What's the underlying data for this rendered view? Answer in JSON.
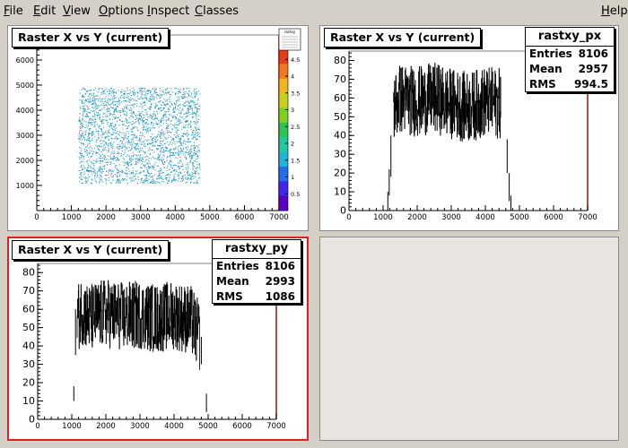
{
  "menu": {
    "file": {
      "u": "F",
      "rest": "ile"
    },
    "edit": {
      "u": "E",
      "rest": "dit"
    },
    "view": {
      "u": "V",
      "rest": "iew"
    },
    "options": {
      "u": "O",
      "rest": "ptions"
    },
    "inspect": {
      "u": "I",
      "rest": "nspect"
    },
    "classes": {
      "u": "C",
      "rest": "lasses"
    },
    "help": {
      "u": "H",
      "rest": "elp"
    }
  },
  "pads": {
    "top_left": {
      "title": "Raster X vs Y (current)",
      "palette_header": "rastxy",
      "palette_ticks": [
        "0.5",
        "1",
        "1.5",
        "2",
        "2.5",
        "3",
        "3.5",
        "4",
        "4.5"
      ],
      "x_ticks": [
        "0",
        "1000",
        "2000",
        "3000",
        "4000",
        "5000",
        "6000",
        "7000"
      ],
      "y_ticks": [
        "1000",
        "2000",
        "3000",
        "4000",
        "5000",
        "6000"
      ]
    },
    "top_right": {
      "title": "Raster X vs Y (current)",
      "stats": {
        "name": "rastxy_px",
        "entries_label": "Entries",
        "entries": "8106",
        "mean_label": "Mean",
        "mean": "2957",
        "rms_label": "RMS",
        "rms": "994.5"
      },
      "x_ticks": [
        "0",
        "1000",
        "2000",
        "3000",
        "4000",
        "5000",
        "6000",
        "7000"
      ],
      "y_ticks": [
        "0",
        "10",
        "20",
        "30",
        "40",
        "50",
        "60",
        "70",
        "80"
      ]
    },
    "bottom_left": {
      "title": "Raster X vs Y (current)",
      "stats": {
        "name": "rastxy_py",
        "entries_label": "Entries",
        "entries": "8106",
        "mean_label": "Mean",
        "mean": "2993",
        "rms_label": "RMS",
        "rms": "1086"
      },
      "x_ticks": [
        "0",
        "1000",
        "2000",
        "3000",
        "4000",
        "5000",
        "6000",
        "7000"
      ],
      "y_ticks": [
        "0",
        "10",
        "20",
        "30",
        "40",
        "50",
        "60",
        "70",
        "80"
      ]
    }
  },
  "colors": {
    "scatter": "#1e96c8",
    "frame_right": "#a01010",
    "active_border": "#dd2020",
    "palette": [
      "#5a00c8",
      "#3c28f0",
      "#1e6ef0",
      "#1eb4dc",
      "#1ec8a0",
      "#28c850",
      "#78d21e",
      "#c8d21e",
      "#f0b41e",
      "#f0781e",
      "#e63c1e"
    ]
  },
  "chart_data": [
    {
      "type": "scatter",
      "title": "Raster X vs Y (current)",
      "xlim": [
        0,
        7000
      ],
      "ylim": [
        0,
        7000
      ],
      "region": {
        "x": [
          1200,
          4700
        ],
        "y": [
          1100,
          4900
        ]
      },
      "z_range": [
        0,
        4.8
      ],
      "note_values": "uniform 2D raster fill, density ~1-1.5 counts per bin"
    },
    {
      "type": "bar",
      "name": "rastxy_px",
      "xlim": [
        0,
        7000
      ],
      "ylim": [
        0,
        85
      ],
      "x": [
        1150,
        1300,
        1500,
        2000,
        2500,
        3000,
        3500,
        4000,
        4450,
        4650,
        4750
      ],
      "values": [
        10,
        55,
        60,
        58,
        60,
        57,
        55,
        58,
        57,
        35,
        3
      ]
    },
    {
      "type": "bar",
      "name": "rastxy_py",
      "xlim": [
        0,
        7000
      ],
      "ylim": [
        0,
        85
      ],
      "x": [
        1050,
        1150,
        1300,
        1500,
        2000,
        2500,
        3000,
        3500,
        4000,
        4500,
        4750,
        4950
      ],
      "values": [
        14,
        55,
        60,
        55,
        58,
        56,
        57,
        55,
        57,
        54,
        45,
        10
      ]
    }
  ]
}
